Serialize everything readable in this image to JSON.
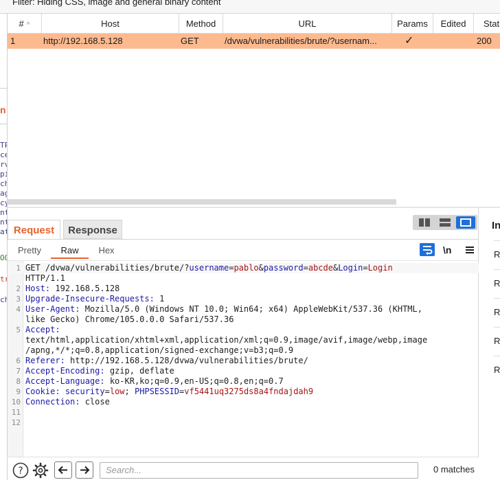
{
  "filter_text": "Filter: Hiding CSS, image and general binary content",
  "left_fragments": {
    "orange": "n",
    "lines": [
      "TP",
      "ce",
      "rv",
      "pi",
      "ch",
      "ag",
      "cy",
      "nt",
      "nt",
      "at"
    ],
    "item_a": "OO",
    "item_b": "tr",
    "item_c": "ch"
  },
  "table": {
    "columns": [
      "#",
      "Host",
      "Method",
      "URL",
      "Params",
      "Edited",
      "Status"
    ],
    "sort_indicator": "^",
    "rows": [
      {
        "num": "1",
        "host": "http://192.168.5.128",
        "method": "GET",
        "url": "/dvwa/vulnerabilities/brute/?usernam...",
        "params": "✓",
        "edited": "",
        "status": "200"
      }
    ]
  },
  "tabs": {
    "request": "Request",
    "response": "Response"
  },
  "sub_tabs": {
    "pretty": "Pretty",
    "raw": "Raw",
    "hex": "Hex"
  },
  "tools": {
    "newline": "\\n"
  },
  "request_lines": [
    {
      "num": "1",
      "parts": [
        {
          "t": "GET /dvwa/vulnerabilities/brute/?",
          "c": "p"
        },
        {
          "t": "username",
          "c": "k"
        },
        {
          "t": "=",
          "c": "p"
        },
        {
          "t": "pablo",
          "c": "v"
        },
        {
          "t": "&",
          "c": "p"
        },
        {
          "t": "password",
          "c": "k"
        },
        {
          "t": "=",
          "c": "p"
        },
        {
          "t": "abcde",
          "c": "v"
        },
        {
          "t": "&",
          "c": "p"
        },
        {
          "t": "Login",
          "c": "k"
        },
        {
          "t": "=",
          "c": "p"
        },
        {
          "t": "Login",
          "c": "v"
        }
      ]
    },
    {
      "num": "",
      "parts": [
        {
          "t": "HTTP/1.1",
          "c": "p"
        }
      ]
    },
    {
      "num": "2",
      "parts": [
        {
          "t": "Host:",
          "c": "k"
        },
        {
          "t": " 192.168.5.128",
          "c": "p"
        }
      ]
    },
    {
      "num": "3",
      "parts": [
        {
          "t": "Upgrade-Insecure-Requests:",
          "c": "k"
        },
        {
          "t": " 1",
          "c": "p"
        }
      ]
    },
    {
      "num": "4",
      "parts": [
        {
          "t": "User-Agent:",
          "c": "k"
        },
        {
          "t": " Mozilla/5.0 (Windows NT 10.0; Win64; x64) AppleWebKit/537.36 (KHTML,",
          "c": "p"
        }
      ]
    },
    {
      "num": "",
      "parts": [
        {
          "t": "like Gecko) Chrome/105.0.0.0 Safari/537.36",
          "c": "p"
        }
      ]
    },
    {
      "num": "5",
      "parts": [
        {
          "t": "Accept:",
          "c": "k"
        }
      ]
    },
    {
      "num": "",
      "parts": [
        {
          "t": "text/html,application/xhtml+xml,application/xml;q=0.9,image/avif,image/webp,image",
          "c": "p"
        }
      ]
    },
    {
      "num": "",
      "parts": [
        {
          "t": "/apng,*/*;q=0.8,application/signed-exchange;v=b3;q=0.9",
          "c": "p"
        }
      ]
    },
    {
      "num": "6",
      "parts": [
        {
          "t": "Referer:",
          "c": "k"
        },
        {
          "t": " http://192.168.5.128/dvwa/vulnerabilities/brute/",
          "c": "p"
        }
      ]
    },
    {
      "num": "7",
      "parts": [
        {
          "t": "Accept-Encoding:",
          "c": "k"
        },
        {
          "t": " gzip, deflate",
          "c": "p"
        }
      ]
    },
    {
      "num": "8",
      "parts": [
        {
          "t": "Accept-Language:",
          "c": "k"
        },
        {
          "t": " ko-KR,ko;q=0.9,en-US;q=0.8,en;q=0.7",
          "c": "p"
        }
      ]
    },
    {
      "num": "9",
      "parts": [
        {
          "t": "Cookie:",
          "c": "k"
        },
        {
          "t": " ",
          "c": "p"
        },
        {
          "t": "security",
          "c": "k"
        },
        {
          "t": "=",
          "c": "p"
        },
        {
          "t": "low",
          "c": "v"
        },
        {
          "t": "; ",
          "c": "p"
        },
        {
          "t": "PHPSESSID",
          "c": "k"
        },
        {
          "t": "=",
          "c": "p"
        },
        {
          "t": "vf5441uq3275ds8a4fndajdah9",
          "c": "v"
        }
      ]
    },
    {
      "num": "10",
      "parts": [
        {
          "t": "Connection:",
          "c": "k"
        },
        {
          "t": " close",
          "c": "p"
        }
      ]
    },
    {
      "num": "11",
      "parts": []
    },
    {
      "num": "12",
      "parts": []
    }
  ],
  "search": {
    "placeholder": "Search...",
    "matches": "0 matches"
  },
  "inspector": {
    "title": "In",
    "items": [
      "Re",
      "Re",
      "Re",
      "Re",
      "Re"
    ]
  },
  "colors": {
    "accent": "#e8622c",
    "selected_row": "#fdba8f",
    "toggle_blue": "#1e6fd9"
  },
  "icons": [
    "help-icon",
    "settings-gear-icon",
    "arrow-left-icon",
    "arrow-right-icon",
    "wrap-lines-icon",
    "menu-icon",
    "split-horizontal-icon",
    "split-vertical-icon",
    "single-pane-icon"
  ]
}
